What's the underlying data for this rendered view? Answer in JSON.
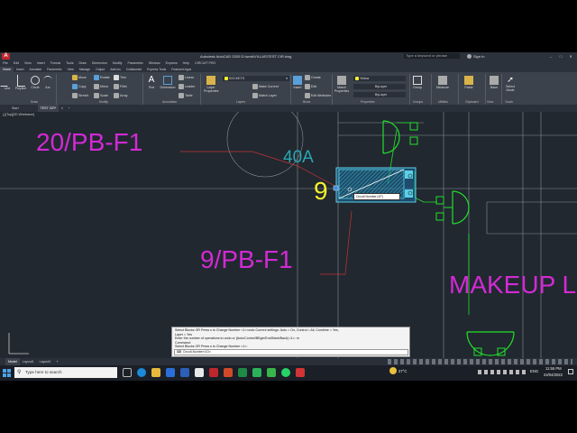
{
  "window": {
    "title": "Autodesk AutoCAD 2020   D:\\work\\VILLAS\\TEST CIR.dwg",
    "search_placeholder": "Type a keyword or phrase",
    "sign_in": "Sign In"
  },
  "menu": [
    "File",
    "Edit",
    "View",
    "Insert",
    "Format",
    "Tools",
    "Draw",
    "Dimension",
    "Modify",
    "Parametric",
    "Window",
    "Express",
    "Help",
    "CIRCUIT PRO"
  ],
  "ribbon_tabs": [
    "Home",
    "Insert",
    "Annotate",
    "Parametric",
    "View",
    "Manage",
    "Output",
    "Add-ins",
    "Collaborate",
    "Express Tools",
    "Featured Apps"
  ],
  "ribbon": {
    "draw_tools": [
      "Line",
      "Polyline",
      "Circle",
      "Arc"
    ],
    "draw_label": "Draw",
    "modify_tools": [
      "Move",
      "Rotate",
      "Trim",
      "Copy",
      "Mirror",
      "Fillet",
      "Stretch",
      "Scale",
      "Array"
    ],
    "modify_label": "Modify",
    "annotation_tools": [
      "Text",
      "Dimension",
      "Linear",
      "Leader",
      "Table"
    ],
    "annotation_label": "Annotation",
    "layer_tools": [
      "Layer Properties",
      "Make Current",
      "Match Layer"
    ],
    "layer_current": "SOCKETS",
    "layers_label": "Layers",
    "block_tools": [
      "Insert",
      "Create",
      "Edit",
      "Edit Attributes"
    ],
    "block_label": "Block",
    "properties_tools": [
      "Match Properties"
    ],
    "color_value": "Yellow",
    "linetype_value": "ByLayer",
    "lineweight_value": "ByLayer",
    "properties_label": "Properties",
    "groups_tools": [
      "Group"
    ],
    "groups_label": "Groups",
    "utilities_tools": [
      "Measure"
    ],
    "utilities_label": "Utilities",
    "clipboard_tools": [
      "Paste"
    ],
    "clipboard_label": "Clipboard",
    "view_tools": [
      "Base"
    ],
    "view_label": "View",
    "touch_tools": [
      "Select Mode"
    ],
    "touch_label": "Touch"
  },
  "doc_tabs": [
    "Start",
    "TEST CIR*"
  ],
  "viewport_label": "[-][Top][2D Wireframe]",
  "drawing": {
    "label1": "20/PB-F1",
    "label2": "9/PB-F1",
    "label3": "MAKEUP L",
    "circuit_number": "9",
    "breaker_rating": "40A",
    "tooltip": "Circuit Number [1P]"
  },
  "command_lines": [
    "Select Blocks OR Press s to Change Number <1>:undo Current settings: Auto = On, Control = All, Combine = Yes,",
    "Layer = Yes",
    "Enter the number of operations to undo or [Auto/Control/BEgin/End/Mark/Back] <1>: m",
    "Command:",
    "Select Blocks OR Press s to Change Number <1>:"
  ],
  "command_input": "Circuit-Number<10>:",
  "layout_tabs": [
    "Model",
    "Layout1",
    "Layout2"
  ],
  "taskbar": {
    "search_placeholder": "Type here to search",
    "weather": "27°C",
    "language": "ENG",
    "time": "11:55 PM",
    "date": "24/04/2022"
  },
  "colors": {
    "magenta": "#d22ad4",
    "green": "#22e02a",
    "cyan": "#2aa7b3",
    "yellow": "#f4f02a",
    "grey_line": "#8a8f96",
    "red_line": "#c23535"
  }
}
